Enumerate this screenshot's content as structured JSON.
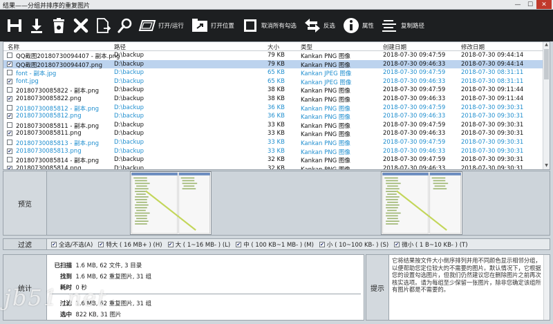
{
  "window": {
    "title": "结果——分组并排序的重复图片",
    "minimize": "—",
    "maximize": "☐",
    "close": "✕"
  },
  "toolbar": {
    "open_run": "打开/运行",
    "open_location": "打开位置",
    "deselect_all": "取消所有勾选",
    "invert": "反选",
    "properties": "属性",
    "copy_path": "复制路径"
  },
  "table": {
    "headers": {
      "name": "名称",
      "path": "路径",
      "size": "大小",
      "type": "类型",
      "created": "创建日期",
      "modified": "修改日期"
    },
    "rows": [
      {
        "checked": false,
        "name": "QQ截图20180730094407 - 副本.png",
        "path": "D:\\backup",
        "size": "79 KB",
        "type": "Kankan PNG 图像",
        "created": "2018-07-30 09:47:59",
        "modified": "2018-07-30 09:44:14",
        "blue": false,
        "selected": false
      },
      {
        "checked": true,
        "name": "QQ截图20180730094407.png",
        "path": "D:\\backup",
        "size": "79 KB",
        "type": "Kankan PNG 图像",
        "created": "2018-07-30 09:46:33",
        "modified": "2018-07-30 09:44:14",
        "blue": false,
        "selected": true
      },
      {
        "checked": false,
        "name": "font - 副本.jpg",
        "path": "D:\\backup",
        "size": "65 KB",
        "type": "Kankan JPEG 图像",
        "created": "2018-07-30 09:47:59",
        "modified": "2018-07-30 08:31:11",
        "blue": true,
        "selected": false
      },
      {
        "checked": true,
        "name": "font.jpg",
        "path": "D:\\backup",
        "size": "65 KB",
        "type": "Kankan JPEG 图像",
        "created": "2018-07-30 09:46:33",
        "modified": "2018-07-30 08:31:11",
        "blue": true,
        "selected": false
      },
      {
        "checked": false,
        "name": "20180730085822 - 副本.png",
        "path": "D:\\backup",
        "size": "38 KB",
        "type": "Kankan PNG 图像",
        "created": "2018-07-30 09:47:59",
        "modified": "2018-07-30 09:11:44",
        "blue": false,
        "selected": false
      },
      {
        "checked": true,
        "name": "20180730085822.png",
        "path": "D:\\backup",
        "size": "38 KB",
        "type": "Kankan PNG 图像",
        "created": "2018-07-30 09:46:33",
        "modified": "2018-07-30 09:11:44",
        "blue": false,
        "selected": false
      },
      {
        "checked": false,
        "name": "20180730085812 - 副本.png",
        "path": "D:\\backup",
        "size": "36 KB",
        "type": "Kankan PNG 图像",
        "created": "2018-07-30 09:47:59",
        "modified": "2018-07-30 09:30:31",
        "blue": true,
        "selected": false
      },
      {
        "checked": true,
        "name": "20180730085812.png",
        "path": "D:\\backup",
        "size": "36 KB",
        "type": "Kankan PNG 图像",
        "created": "2018-07-30 09:46:33",
        "modified": "2018-07-30 09:30:31",
        "blue": true,
        "selected": false
      },
      {
        "checked": false,
        "name": "20180730085811 - 副本.png",
        "path": "D:\\backup",
        "size": "33 KB",
        "type": "Kankan PNG 图像",
        "created": "2018-07-30 09:47:59",
        "modified": "2018-07-30 09:30:31",
        "blue": false,
        "selected": false
      },
      {
        "checked": true,
        "name": "20180730085811.png",
        "path": "D:\\backup",
        "size": "33 KB",
        "type": "Kankan PNG 图像",
        "created": "2018-07-30 09:46:33",
        "modified": "2018-07-30 09:30:31",
        "blue": false,
        "selected": false
      },
      {
        "checked": false,
        "name": "20180730085813 - 副本.png",
        "path": "D:\\backup",
        "size": "33 KB",
        "type": "Kankan PNG 图像",
        "created": "2018-07-30 09:47:59",
        "modified": "2018-07-30 09:30:31",
        "blue": true,
        "selected": false
      },
      {
        "checked": true,
        "name": "20180730085813.png",
        "path": "D:\\backup",
        "size": "33 KB",
        "type": "Kankan PNG 图像",
        "created": "2018-07-30 09:46:33",
        "modified": "2018-07-30 09:30:31",
        "blue": true,
        "selected": false
      },
      {
        "checked": false,
        "name": "20180730085814 - 副本.png",
        "path": "D:\\backup",
        "size": "32 KB",
        "type": "Kankan PNG 图像",
        "created": "2018-07-30 09:47:59",
        "modified": "2018-07-30 09:30:31",
        "blue": false,
        "selected": false
      },
      {
        "checked": true,
        "name": "20180730085814.png",
        "path": "D:\\backup",
        "size": "32 KB",
        "type": "Kankan PNG 图像",
        "created": "2018-07-30 09:46:33",
        "modified": "2018-07-30 09:30:31",
        "blue": false,
        "selected": false
      }
    ]
  },
  "preview": {
    "label": "预览"
  },
  "filter": {
    "label": "过滤",
    "options": [
      {
        "checked": true,
        "label": "全选/不选(A)"
      },
      {
        "checked": true,
        "label": "特大 ( 16 MB+ ) (H)"
      },
      {
        "checked": true,
        "label": "大 ( 1~16 MB- ) (L)"
      },
      {
        "checked": true,
        "label": "中 ( 100 KB~1 MB- ) (M)"
      },
      {
        "checked": true,
        "label": "小 ( 10~100 KB- ) (S)"
      },
      {
        "checked": true,
        "label": "微小 ( 1 B~10 KB- ) (T)"
      }
    ]
  },
  "stats": {
    "label": "统计",
    "scanned_key": "已扫描",
    "scanned_val": "1.6 MB, 62 文件, 3 目录",
    "found_key": "找到",
    "found_val": "1.6 MB, 62 重复图片, 31 组",
    "time_key": "耗时",
    "time_val": "0 秒",
    "filter_key": "过滤",
    "filter_val": "1.6 MB, 62 重复图片, 31 组",
    "sel_key": "选中",
    "sel_val": "822 KB, 31 图片"
  },
  "hint": {
    "label": "提示",
    "text": "它将结果按文件大小倒序排列并用不同颜色显示相邻分组，以便帮助您定位较大的不需要的图片。默认情况下，它根据您的设置勾选图片，但我们仍然建议您在删除图片之前再次核实选项。请为每组至少保留一张图片，除非您确定该组所有图片都是不需要的。"
  },
  "watermark": "jb51.net"
}
